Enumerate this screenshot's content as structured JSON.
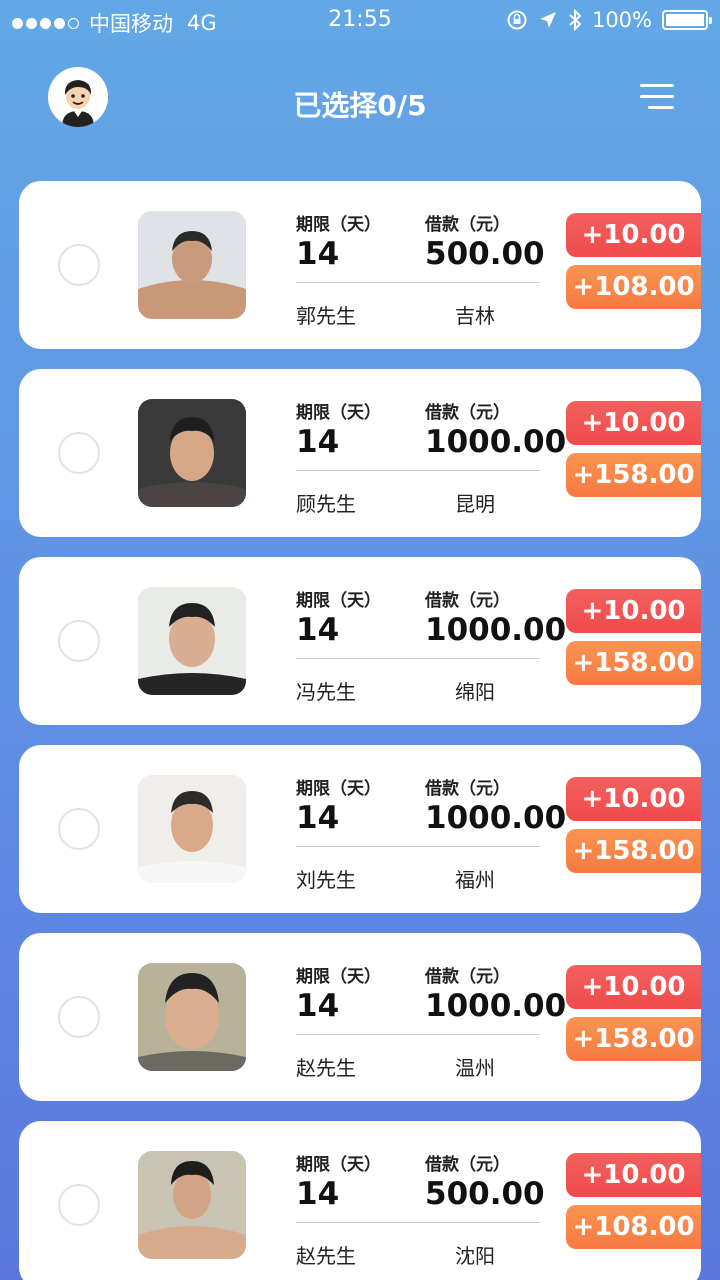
{
  "status_bar": {
    "carrier": "中国移动",
    "network": "4G",
    "time": "21:55",
    "battery": "100%"
  },
  "header": {
    "title": "已选择0/5"
  },
  "labels": {
    "term": "期限（天）",
    "loan": "借款（元）"
  },
  "items": [
    {
      "term": "14",
      "amount": "500.00",
      "name": "郭先生",
      "city": "吉林",
      "price_a": "+10.00",
      "price_b": "+108.00"
    },
    {
      "term": "14",
      "amount": "1000.00",
      "name": "顾先生",
      "city": "昆明",
      "price_a": "+10.00",
      "price_b": "+158.00"
    },
    {
      "term": "14",
      "amount": "1000.00",
      "name": "冯先生",
      "city": "绵阳",
      "price_a": "+10.00",
      "price_b": "+158.00"
    },
    {
      "term": "14",
      "amount": "1000.00",
      "name": "刘先生",
      "city": "福州",
      "price_a": "+10.00",
      "price_b": "+158.00"
    },
    {
      "term": "14",
      "amount": "1000.00",
      "name": "赵先生",
      "city": "温州",
      "price_a": "+10.00",
      "price_b": "+158.00"
    },
    {
      "term": "14",
      "amount": "500.00",
      "name": "赵先生",
      "city": "沈阳",
      "price_a": "+10.00",
      "price_b": "+108.00"
    }
  ]
}
